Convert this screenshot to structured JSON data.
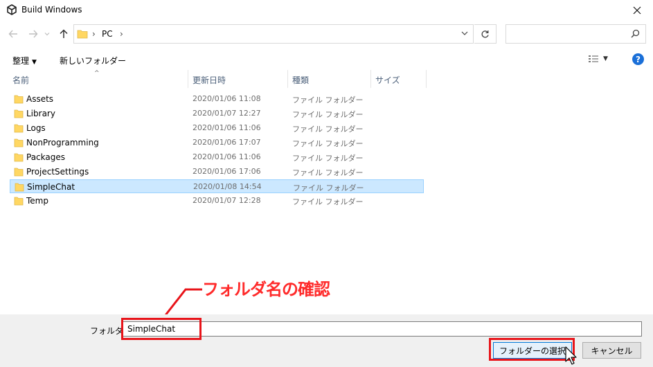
{
  "window": {
    "title": "Build Windows"
  },
  "address": {
    "crumb": "PC",
    "search_placeholder": ""
  },
  "toolbar": {
    "organize_label": "整理",
    "new_folder_label": "新しいフォルダー"
  },
  "columns": {
    "name": "名前",
    "date": "更新日時",
    "type": "種類",
    "size": "サイズ"
  },
  "files": [
    {
      "name": "Assets",
      "date": "2020/01/06 11:08",
      "type": "ファイル フォルダー"
    },
    {
      "name": "Library",
      "date": "2020/01/07 12:27",
      "type": "ファイル フォルダー"
    },
    {
      "name": "Logs",
      "date": "2020/01/06 11:06",
      "type": "ファイル フォルダー"
    },
    {
      "name": "NonProgramming",
      "date": "2020/01/06 17:07",
      "type": "ファイル フォルダー"
    },
    {
      "name": "Packages",
      "date": "2020/01/06 11:06",
      "type": "ファイル フォルダー"
    },
    {
      "name": "ProjectSettings",
      "date": "2020/01/06 17:06",
      "type": "ファイル フォルダー"
    },
    {
      "name": "SimpleChat",
      "date": "2020/01/08 14:54",
      "type": "ファイル フォルダー",
      "selected": true
    },
    {
      "name": "Temp",
      "date": "2020/01/07 12:28",
      "type": "ファイル フォルダー"
    }
  ],
  "annotation": {
    "text": "フォルダ名の確認",
    "color": "#ff2a2a"
  },
  "footer": {
    "folder_label": "フォルダー",
    "folder_value": "SimpleChat",
    "select_label": "フォルダーの選択",
    "cancel_label": "キャンセル"
  },
  "colors": {
    "selection": "#cce8ff",
    "accent": "#0078d7",
    "highlight_box": "#e8141a"
  }
}
